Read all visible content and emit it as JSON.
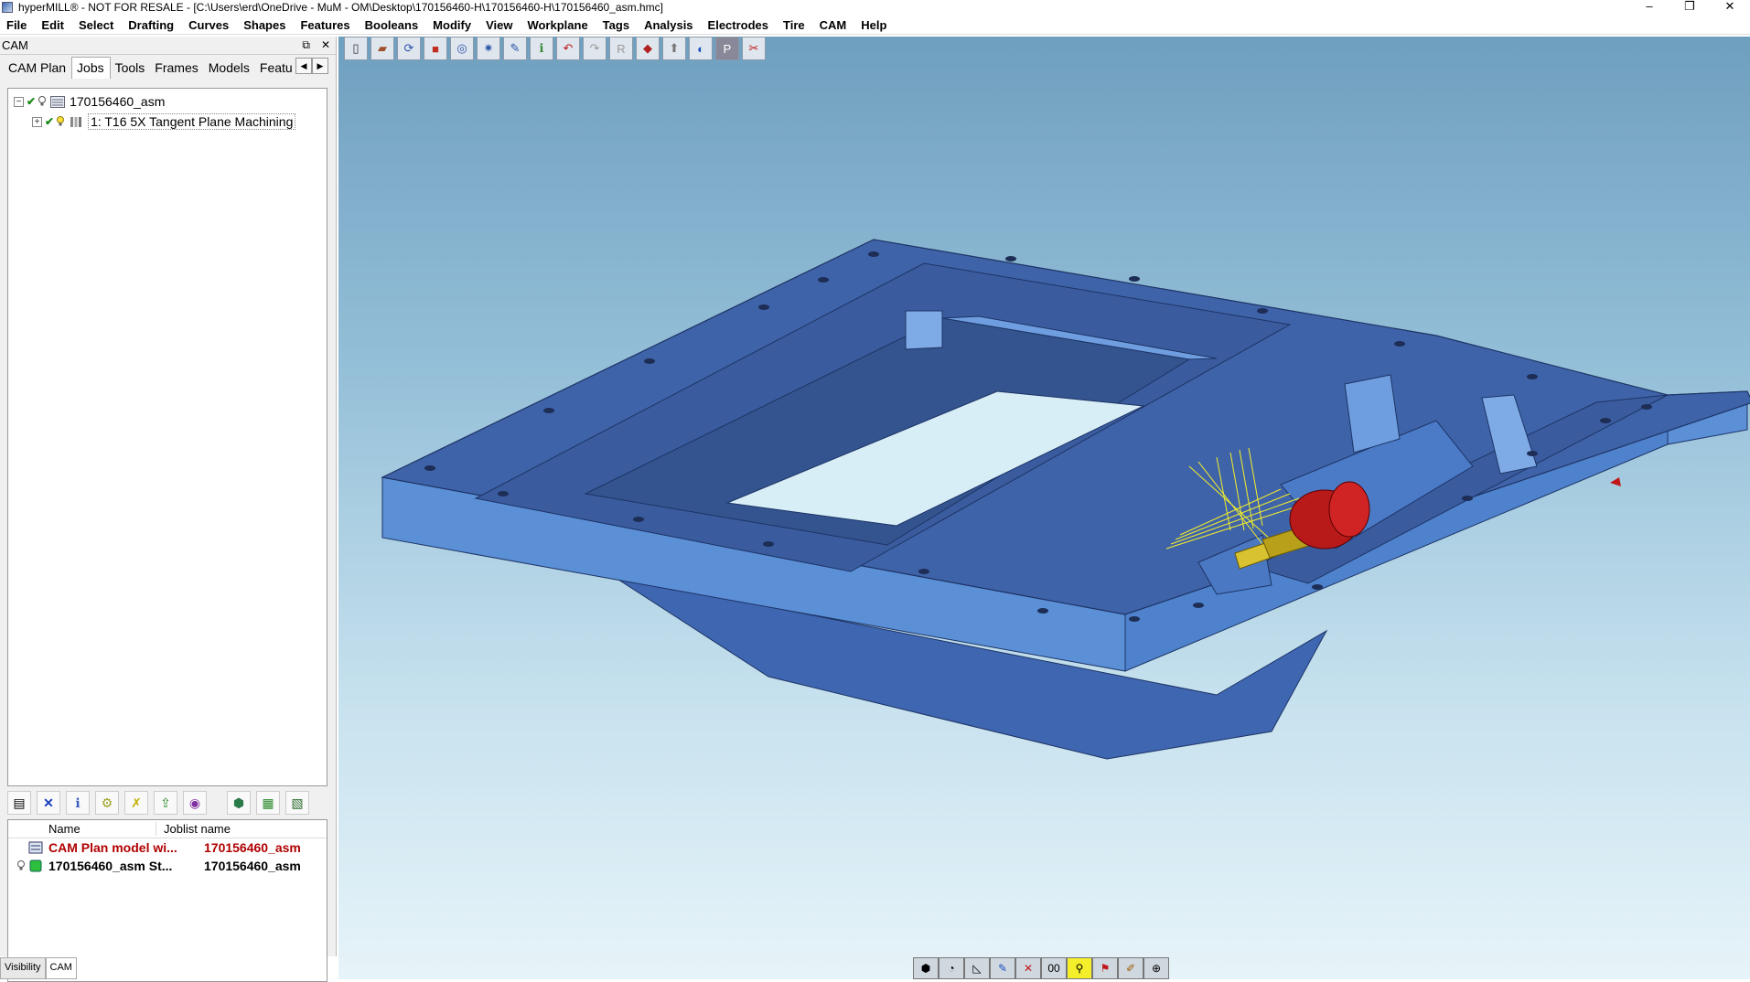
{
  "window": {
    "title": "hyperMILL® - NOT FOR RESALE - [C:\\Users\\erd\\OneDrive - MuM - OM\\Desktop\\170156460-H\\170156460-H\\170156460_asm.hmc]",
    "minimize": "–",
    "restore": "❐",
    "close": "✕"
  },
  "menu": [
    "File",
    "Edit",
    "Select",
    "Drafting",
    "Curves",
    "Shapes",
    "Features",
    "Booleans",
    "Modify",
    "View",
    "Workplane",
    "Tags",
    "Analysis",
    "Electrodes",
    "Tire",
    "CAM",
    "Help"
  ],
  "panel": {
    "title": "CAM",
    "float_btn": "⧉",
    "close_btn": "✕",
    "tabs": [
      "CAM Plan",
      "Jobs",
      "Tools",
      "Frames",
      "Models",
      "Featu"
    ],
    "active_tab": "Jobs",
    "tab_prev": "◀",
    "tab_next": "▶"
  },
  "tree": {
    "root": {
      "expander": "−",
      "label": "170156460_asm"
    },
    "job": {
      "expander": "+",
      "label": "1: T16 5X Tangent Plane Machining"
    }
  },
  "list": {
    "headers": {
      "name": "Name",
      "joblist": "Joblist name"
    },
    "rows": [
      {
        "name": "CAM Plan model wi...",
        "joblist": "170156460_asm",
        "highlight": true
      },
      {
        "name": "170156460_asm St...",
        "joblist": "170156460_asm",
        "highlight": false
      }
    ]
  },
  "bottom_tabs": [
    "Visibility",
    "CAM"
  ],
  "colors": {
    "part_top": "#3f63a8",
    "part_side": "#5b8fd6",
    "toolpath": "#f4ef2a",
    "tool_holder": "#c01818"
  }
}
